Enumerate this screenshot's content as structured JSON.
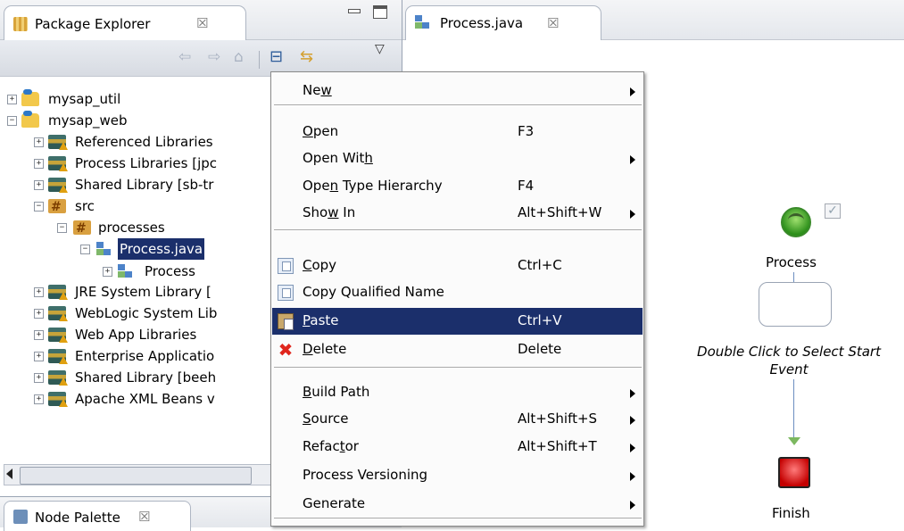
{
  "package_explorer": {
    "tab_title": "Package Explorer",
    "close_glyph": "☒",
    "toolbar_glyphs": {
      "back": "⇦",
      "forward": "⇨",
      "home": "⌂",
      "collapse": "⊟",
      "link": "⇆",
      "menu": "▽"
    },
    "tree": [
      {
        "label": "mysap_util",
        "expander": "+",
        "icon": "project-icon"
      },
      {
        "label": "mysap_web",
        "expander": "−",
        "icon": "web-project-icon"
      },
      {
        "label": "Referenced Libraries",
        "expander": "+",
        "icon": "library-icon"
      },
      {
        "label": "Process Libraries [jpc",
        "expander": "+",
        "icon": "library-icon"
      },
      {
        "label": "Shared Library [sb-tr",
        "expander": "+",
        "icon": "library-icon"
      },
      {
        "label": "src",
        "expander": "−",
        "icon": "source-folder-icon"
      },
      {
        "label": "processes",
        "expander": "−",
        "icon": "package-icon"
      },
      {
        "label": "Process.java",
        "expander": "−",
        "icon": "process-file-icon",
        "selected": true
      },
      {
        "label": "Process",
        "expander": "+",
        "icon": "process-icon"
      },
      {
        "label": "JRE System Library [",
        "expander": "+",
        "icon": "library-icon"
      },
      {
        "label": "WebLogic System Lib",
        "expander": "+",
        "icon": "library-icon"
      },
      {
        "label": "Web App Libraries",
        "expander": "+",
        "icon": "library-icon"
      },
      {
        "label": "Enterprise Applicatio",
        "expander": "+",
        "icon": "library-icon"
      },
      {
        "label": "Shared Library [beeh",
        "expander": "+",
        "icon": "library-icon"
      },
      {
        "label": "Apache XML Beans v",
        "expander": "+",
        "icon": "library-icon"
      }
    ]
  },
  "node_palette": {
    "tab_title": "Node Palette",
    "close_glyph": "☒"
  },
  "editor": {
    "tab_title": "Process.java",
    "close_glyph": "☒",
    "diagram": {
      "start_label": "Process",
      "check_glyph": "✓",
      "hint_line1": "Double Click to Select Start",
      "hint_line2": "Event",
      "finish_label": "Finish"
    }
  },
  "context_menu": {
    "items": [
      {
        "type": "item",
        "name": "menu-new",
        "label_pre": "Ne",
        "mnemonic": "w",
        "label_post": "",
        "shortcut": "",
        "submenu": true
      },
      {
        "type": "separator"
      },
      {
        "type": "item",
        "name": "menu-open",
        "label_pre": "",
        "mnemonic": "O",
        "label_post": "pen",
        "shortcut": "F3",
        "submenu": false
      },
      {
        "type": "item",
        "name": "menu-open-with",
        "label_pre": "Open Wit",
        "mnemonic": "h",
        "label_post": "",
        "shortcut": "",
        "submenu": true
      },
      {
        "type": "item",
        "name": "menu-open-type-hierarchy",
        "label_pre": "Ope",
        "mnemonic": "n",
        "label_post": " Type Hierarchy",
        "shortcut": "F4",
        "submenu": false
      },
      {
        "type": "item",
        "name": "menu-show-in",
        "label_pre": "Sho",
        "mnemonic": "w",
        "label_post": " In",
        "shortcut": "Alt+Shift+W",
        "submenu": true
      },
      {
        "type": "separator"
      },
      {
        "type": "item",
        "name": "menu-copy",
        "label_pre": "",
        "mnemonic": "C",
        "label_post": "opy",
        "shortcut": "Ctrl+C",
        "submenu": false,
        "icon": "copy-icon"
      },
      {
        "type": "item",
        "name": "menu-copy-qualified-name",
        "label_pre": "Copy Qualified Name",
        "mnemonic": "",
        "label_post": "",
        "shortcut": "",
        "submenu": false,
        "icon": "copy-qualified-name-icon"
      },
      {
        "type": "item",
        "name": "menu-paste",
        "label_pre": "",
        "mnemonic": "P",
        "label_post": "aste",
        "shortcut": "Ctrl+V",
        "submenu": false,
        "icon": "paste-icon",
        "selected": true
      },
      {
        "type": "item",
        "name": "menu-delete",
        "label_pre": "",
        "mnemonic": "D",
        "label_post": "elete",
        "shortcut": "Delete",
        "submenu": false,
        "icon": "delete-icon"
      },
      {
        "type": "separator"
      },
      {
        "type": "item",
        "name": "menu-build-path",
        "label_pre": "",
        "mnemonic": "B",
        "label_post": "uild Path",
        "shortcut": "",
        "submenu": true
      },
      {
        "type": "item",
        "name": "menu-source",
        "label_pre": "",
        "mnemonic": "S",
        "label_post": "ource",
        "shortcut": "Alt+Shift+S",
        "submenu": true
      },
      {
        "type": "item",
        "name": "menu-refactor",
        "label_pre": "Refac",
        "mnemonic": "t",
        "label_post": "or",
        "shortcut": "Alt+Shift+T",
        "submenu": true
      },
      {
        "type": "item",
        "name": "menu-process-versioning",
        "label_pre": "Process Versioning",
        "mnemonic": "",
        "label_post": "",
        "shortcut": "",
        "submenu": true
      },
      {
        "type": "item",
        "name": "menu-generate",
        "label_pre": "Generate",
        "mnemonic": "",
        "label_post": "",
        "shortcut": "",
        "submenu": true
      },
      {
        "type": "separator"
      }
    ]
  },
  "colors": {
    "selection": "#1b2f6b",
    "tab_border": "#aeb6c3",
    "menu_bg": "#fbfbfb"
  }
}
